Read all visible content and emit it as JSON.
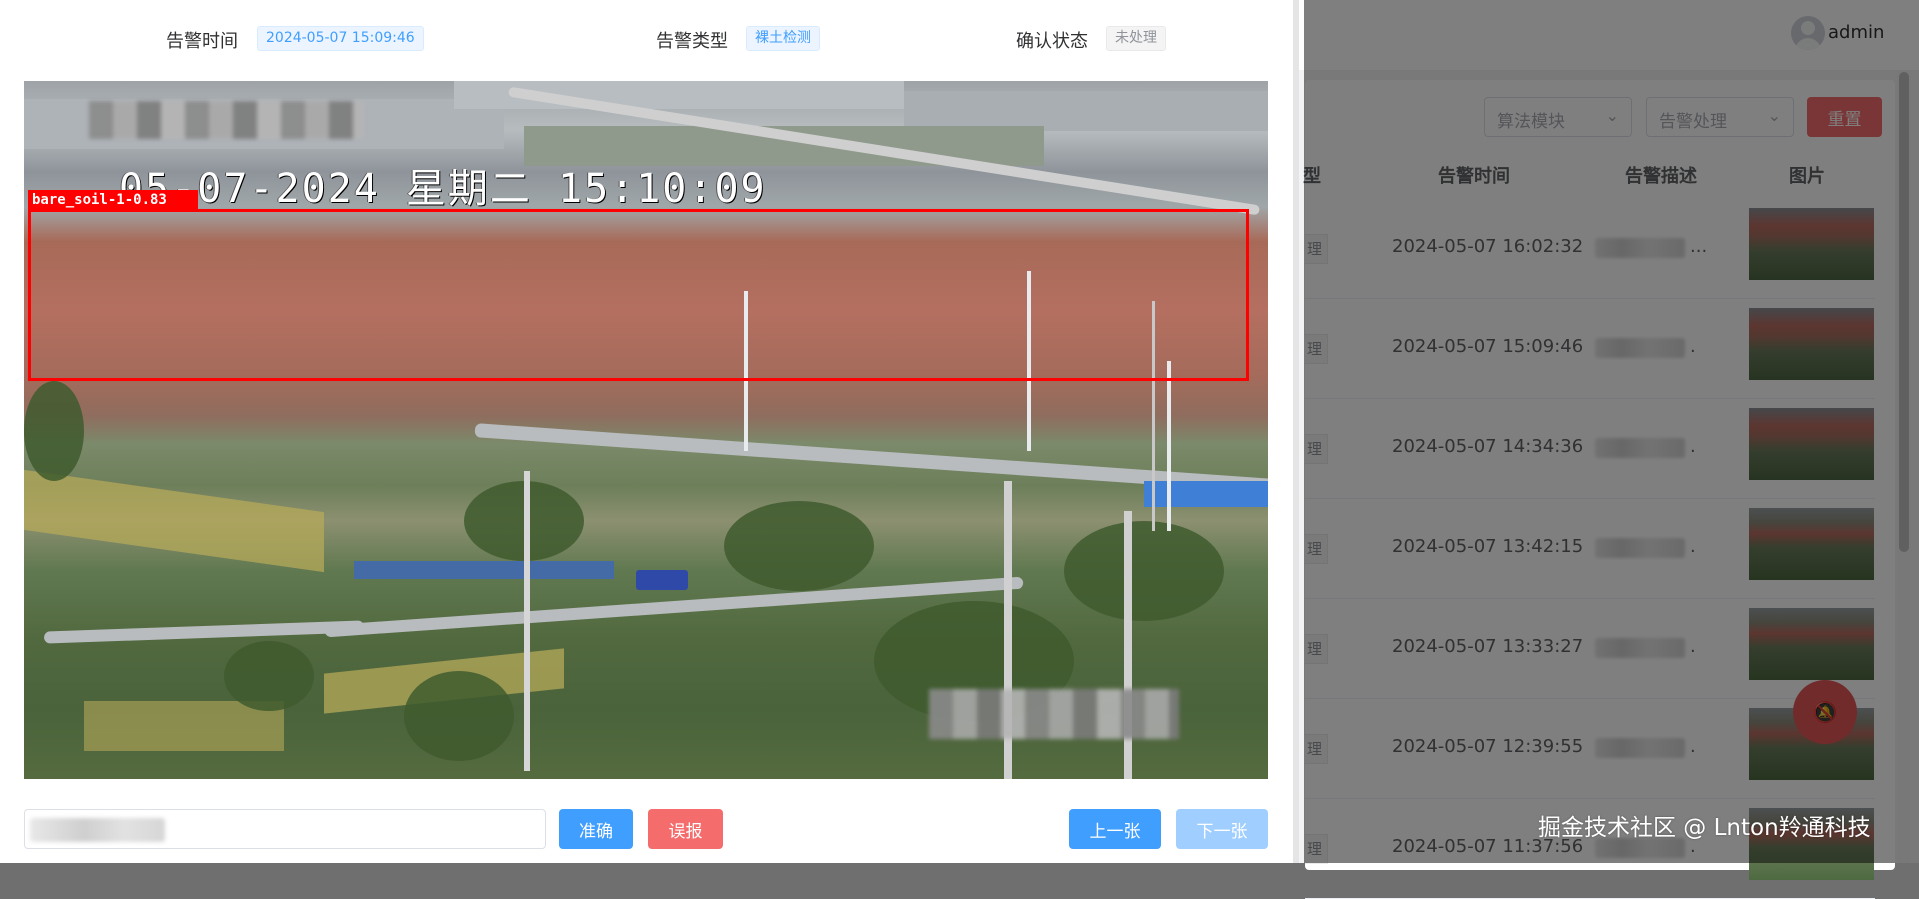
{
  "dialog": {
    "alarm_time_label": "告警时间",
    "alarm_time_value": "2024-05-07 15:09:46",
    "alarm_type_label": "告警类型",
    "alarm_type_value": "裸土检测",
    "confirm_status_label": "确认状态",
    "confirm_status_value": "未处理",
    "image": {
      "camera_timestamp": "05-07-2024 星期二 15:10:09",
      "detection_label": "bare_soil-1-0.83"
    },
    "buttons": {
      "accurate": "准确",
      "false_alarm": "误报",
      "previous": "上一张",
      "next": "下一张"
    }
  },
  "background": {
    "username": "admin",
    "filters": {
      "algorithm_module_placeholder": "算法模块",
      "alarm_handling_placeholder": "告警处理",
      "reset_label": "重置"
    },
    "table": {
      "headers": [
        "型",
        "告警时间",
        "告警描述",
        "图片"
      ],
      "rows": [
        {
          "tag": "理",
          "time": "2024-05-07 16:02:32",
          "desc_suffix": "..."
        },
        {
          "tag": "理",
          "time": "2024-05-07 15:09:46",
          "desc_suffix": "."
        },
        {
          "tag": "理",
          "time": "2024-05-07 14:34:36",
          "desc_suffix": "."
        },
        {
          "tag": "理",
          "time": "2024-05-07 13:42:15",
          "desc_suffix": "."
        },
        {
          "tag": "理",
          "time": "2024-05-07 13:33:27",
          "desc_suffix": "."
        },
        {
          "tag": "理",
          "time": "2024-05-07 12:39:55",
          "desc_suffix": "."
        },
        {
          "tag": "理",
          "time": "2024-05-07 11:37:56",
          "desc_suffix": "."
        }
      ]
    }
  },
  "watermark": "掘金技术社区 @ Lnton羚通科技",
  "colors": {
    "primary": "#409eff",
    "danger": "#f56c6c",
    "primary_disabled": "#a0cfff",
    "detection_box": "#ff0000"
  },
  "icons": {
    "avatar": "user-avatar-icon",
    "select_chevron": "chevron-down-icon",
    "float_button": "bell-off-icon"
  }
}
